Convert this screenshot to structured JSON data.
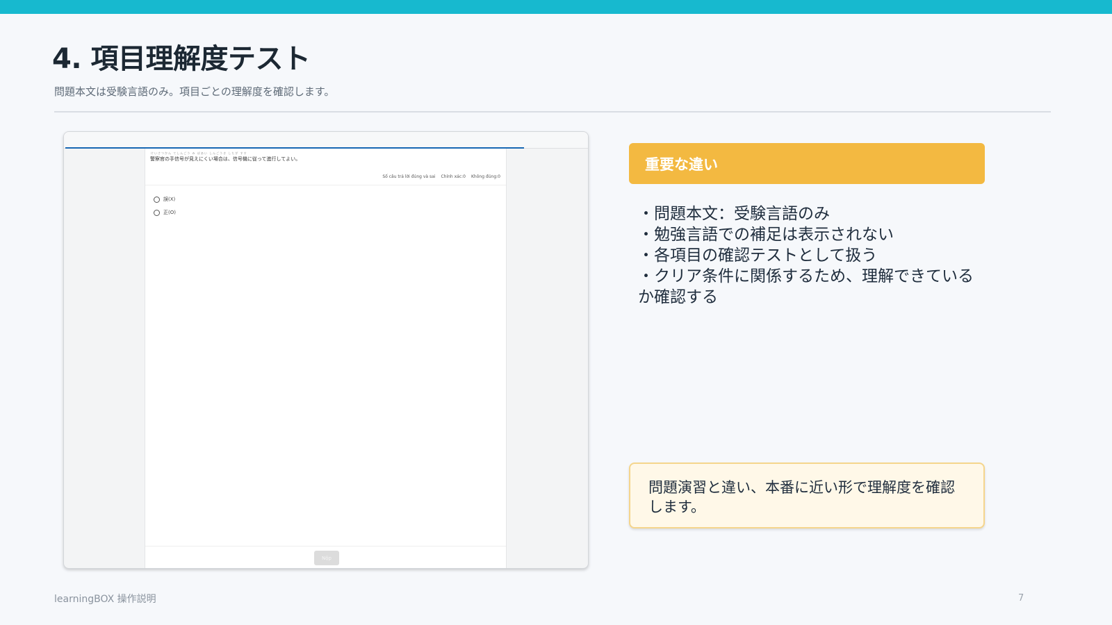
{
  "slide": {
    "title": "4. 項目理解度テスト",
    "subtitle": "問題本文は受験言語のみ。項目ごとの理解度を確認します。",
    "footer_left": "learningBOX 操作説明",
    "page_number": "7"
  },
  "quiz": {
    "ruby_line": "けいさつかん てしんごう み ばあい しんごうき したが すす",
    "question": "警察官の手信号が見えにくい場合は、信号機に従って進行してよい。",
    "stats": {
      "answered": "Số câu trả lời đúng và sai",
      "correct": "Chính xác:0",
      "wrong": "Không đúng:0"
    },
    "options": [
      "誤(X)",
      "正(O)"
    ],
    "submit_label": "Nộp",
    "progress": 0.88
  },
  "callout": {
    "heading": "重要な違い",
    "bullets": [
      "・問題本文：受験言語のみ",
      "・勉強言語での補足は表示されない",
      "・各項目の確認テストとして扱う",
      "・クリア条件に関係するため、理解できているか確認する"
    ],
    "note": "問題演習と違い、本番に近い形で理解度を確認します。"
  },
  "colors": {
    "accent": "#17b9cf",
    "callout": "#f3b941",
    "note_bg": "#fff8e8",
    "progress": "#1767b3"
  }
}
